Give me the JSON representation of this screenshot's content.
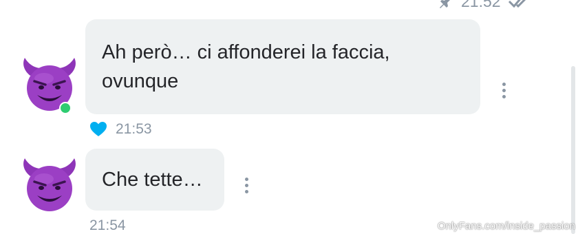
{
  "messages": [
    {
      "text": "Ah però… ci affonderei la faccia, ovunque",
      "time": "21:53",
      "liked": true
    },
    {
      "text": "Che tette…",
      "time": "21:54",
      "liked": false
    }
  ],
  "previous_message_time": "21:52",
  "watermark": "OnlyFans.com/inside_passion",
  "colors": {
    "bubble": "#eef1f2",
    "meta_text": "#8a96a3",
    "like": "#00aff0",
    "online": "#2ecc71",
    "devil": "#9b3fc4"
  },
  "icons": {
    "avatar": "smiling-devil-emoji",
    "like": "heart-icon",
    "menu": "more-vertical-icon",
    "pin": "pin-icon",
    "read": "double-check-icon"
  }
}
